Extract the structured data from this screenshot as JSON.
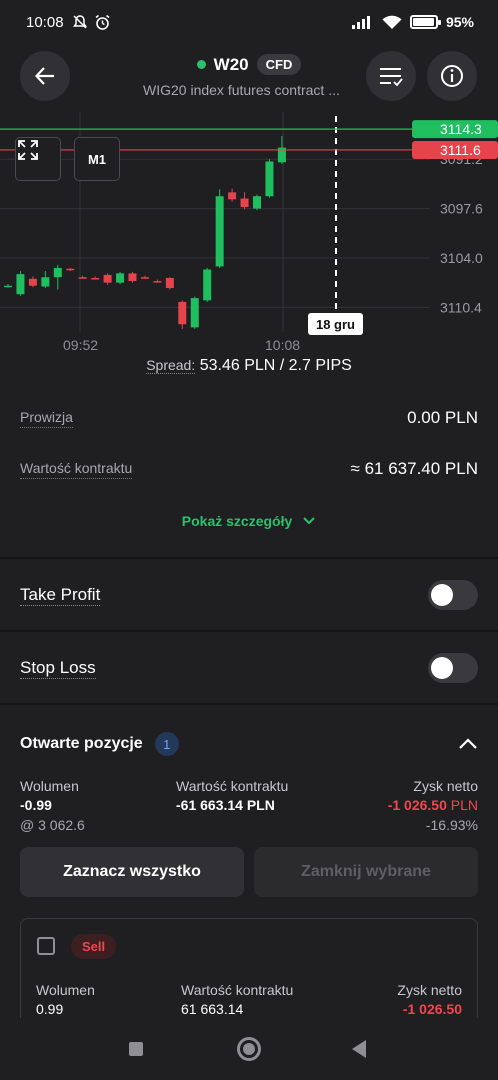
{
  "status_bar": {
    "time": "10:08",
    "battery": "95%",
    "battery_level": 0.95,
    "icons": [
      "do-not-disturb-icon",
      "alarm-icon",
      "signal-icon",
      "wifi-icon",
      "battery-icon"
    ]
  },
  "header": {
    "symbol": "W20",
    "badge": "CFD",
    "subtitle": "WIG20 index futures contract ...",
    "status_color": "#29c26a"
  },
  "chart": {
    "timeframe": "M1",
    "buy_price": "3114.3",
    "sell_price": "3111.6",
    "y_ticks": [
      "3110.4",
      "3104.0",
      "3097.6",
      "3091.2"
    ],
    "x_ticks": [
      "09:52",
      "10:08"
    ],
    "crosshair_label": "18 gru",
    "spread_label": "Spread:",
    "spread_value": "53.46 PLN / 2.7 PIPS",
    "colors": {
      "up": "#1fbf5f",
      "down": "#e5444c",
      "buy_line": "#1fbf5f",
      "sell_line": "#e5444c"
    }
  },
  "chart_data": {
    "type": "candlestick",
    "x_range": [
      "09:52",
      "10:08"
    ],
    "ylim": [
      3088,
      3116
    ],
    "y_ticks": [
      3091.2,
      3097.6,
      3104.0,
      3110.4
    ],
    "candles": [
      {
        "o": 3094.0,
        "c": 3094.0,
        "h": 3094.2,
        "l": 3093.8
      },
      {
        "o": 3092.9,
        "c": 3095.5,
        "h": 3095.9,
        "l": 3092.7
      },
      {
        "o": 3094.9,
        "c": 3094.0,
        "h": 3095.2,
        "l": 3093.8
      },
      {
        "o": 3093.9,
        "c": 3095.1,
        "h": 3095.9,
        "l": 3093.7
      },
      {
        "o": 3095.1,
        "c": 3096.3,
        "h": 3096.7,
        "l": 3093.5
      },
      {
        "o": 3096.2,
        "c": 3096.1,
        "h": 3096.3,
        "l": 3095.9
      },
      {
        "o": 3095.1,
        "c": 3095.0,
        "h": 3095.3,
        "l": 3094.9
      },
      {
        "o": 3095.0,
        "c": 3094.9,
        "h": 3095.2,
        "l": 3094.8
      },
      {
        "o": 3095.4,
        "c": 3094.4,
        "h": 3095.6,
        "l": 3094.1
      },
      {
        "o": 3094.4,
        "c": 3095.6,
        "h": 3095.8,
        "l": 3094.2
      },
      {
        "o": 3095.6,
        "c": 3094.6,
        "h": 3095.8,
        "l": 3094.4
      },
      {
        "o": 3095.1,
        "c": 3095.0,
        "h": 3095.3,
        "l": 3094.9
      },
      {
        "o": 3094.6,
        "c": 3094.5,
        "h": 3094.8,
        "l": 3094.4
      },
      {
        "o": 3095.0,
        "c": 3093.7,
        "h": 3095.1,
        "l": 3093.5
      },
      {
        "o": 3091.9,
        "c": 3089.0,
        "h": 3092.1,
        "l": 3088.4
      },
      {
        "o": 3088.6,
        "c": 3092.4,
        "h": 3092.6,
        "l": 3088.4
      },
      {
        "o": 3092.1,
        "c": 3096.1,
        "h": 3096.3,
        "l": 3091.9
      },
      {
        "o": 3096.5,
        "c": 3105.6,
        "h": 3106.5,
        "l": 3096.3
      },
      {
        "o": 3106.1,
        "c": 3105.2,
        "h": 3106.6,
        "l": 3104.9
      },
      {
        "o": 3105.3,
        "c": 3104.2,
        "h": 3106.1,
        "l": 3103.9
      },
      {
        "o": 3104.0,
        "c": 3105.6,
        "h": 3105.8,
        "l": 3103.8
      },
      {
        "o": 3105.6,
        "c": 3110.1,
        "h": 3110.4,
        "l": 3105.4
      },
      {
        "o": 3110.0,
        "c": 3111.9,
        "h": 3113.4,
        "l": 3109.8
      }
    ]
  },
  "info": {
    "commission_label": "Prowizja",
    "commission_value": "0.00 PLN",
    "contract_value_label": "Wartość kontraktu",
    "contract_value": "≈ 61 637.40 PLN",
    "details_link": "Pokaż szczegóły"
  },
  "take_profit": {
    "label": "Take Profit",
    "enabled": false
  },
  "stop_loss": {
    "label": "Stop Loss",
    "enabled": false
  },
  "positions": {
    "title": "Otwarte pozycje",
    "count": "1",
    "summary": {
      "volume_label": "Wolumen",
      "volume": "-0.99",
      "open_price": "@ 3 062.6",
      "contract_value_label": "Wartość kontraktu",
      "contract_value": "-61 663.14 PLN",
      "profit_label": "Zysk netto",
      "profit": "-1 026.50",
      "profit_currency": "PLN",
      "profit_percent": "-16.93%"
    },
    "select_all_button": "Zaznacz wszystko",
    "close_selected_button": "Zamknij wybrane",
    "card": {
      "side": "Sell",
      "volume_label": "Wolumen",
      "volume": "0.99",
      "contract_value_label": "Wartość kontraktu",
      "contract_value": "61 663.14",
      "profit_label": "Zysk netto",
      "profit": "-1 026.50"
    }
  }
}
